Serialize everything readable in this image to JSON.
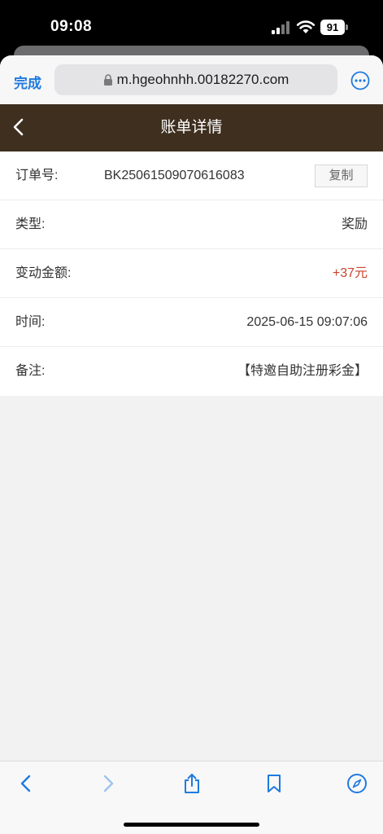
{
  "status_bar": {
    "time": "09:08",
    "battery": "91",
    "icons": [
      "signal-icon",
      "wifi-icon",
      "battery-icon"
    ]
  },
  "browser": {
    "done_label": "完成",
    "url": "m.hgeohnhh.00182270.com",
    "accent_color": "#1f7ae0"
  },
  "header": {
    "title": "账单详情",
    "background_color": "#3e2f1f"
  },
  "details": {
    "order_label": "订单号:",
    "order_value": "BK25061509070616083",
    "copy_label": "复制",
    "type_label": "类型:",
    "type_value": "奖励",
    "amount_label": "变动金额:",
    "amount_value": "+37元",
    "amount_color": "#c8452d",
    "time_label": "时间:",
    "time_value": "2025-06-15 09:07:06",
    "note_label": "备注:",
    "note_value": "【特邀自助注册彩金】"
  },
  "toolbar": {
    "icons": [
      "back-icon",
      "forward-icon",
      "share-icon",
      "bookmarks-icon",
      "compass-icon"
    ]
  }
}
